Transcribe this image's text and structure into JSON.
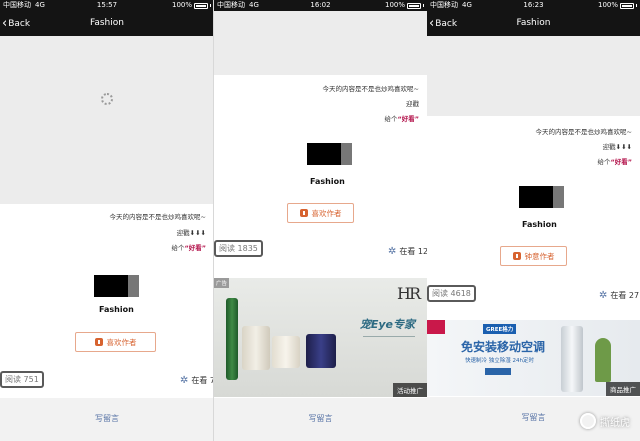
{
  "statusbar": {
    "carrier": "中国移动",
    "network": "4G",
    "battery": "100%"
  },
  "panels": [
    {
      "time": "15:57",
      "back": "Back",
      "title": "Fashion",
      "lines": [
        "今天的内容是不是也炒鸡喜欢呢~",
        "迎戳⬇⬇⬇",
        "给个",
        "“好看”"
      ],
      "brand": "Fashion",
      "like": "喜欢作者",
      "reads": "阅读 751",
      "zaikan": "在看 7",
      "comment": "写留言"
    },
    {
      "time": "16:02",
      "back": "Back",
      "title": "Fashion",
      "lines": [
        "今天的内容是不是也炒鸡喜欢呢~",
        "迎戳",
        "给个",
        "“好看”"
      ],
      "brand": "Fashion",
      "like": "喜欢作者",
      "reads": "阅读 1835",
      "zaikan": "在看 12",
      "comment": "写留言",
      "ad": {
        "badge": "广告",
        "logo": "HR",
        "headline": "宠Eye专家",
        "tag": "活动推广"
      }
    },
    {
      "time": "16:23",
      "back": "Back",
      "title": "Fashion",
      "lines": [
        "今天的内容是不是也炒鸡喜欢呢~",
        "迎戳⬇⬇⬇",
        "给个",
        "“好看”"
      ],
      "brand": "Fashion",
      "like": "钟意作者",
      "reads": "阅读 4618",
      "zaikan": "在看 27",
      "comment": "写留言",
      "ad": {
        "brand": "GREE格力",
        "headline": "免安装移动空调",
        "sub": "快速制冷 独立除湿 24h定时",
        "tag": "商品推广"
      },
      "watermark": "撕纸虎"
    }
  ],
  "colors": {
    "bar": "#141414",
    "accent": "#d76330",
    "link": "#5773a5",
    "highlight": "#b3134b"
  }
}
